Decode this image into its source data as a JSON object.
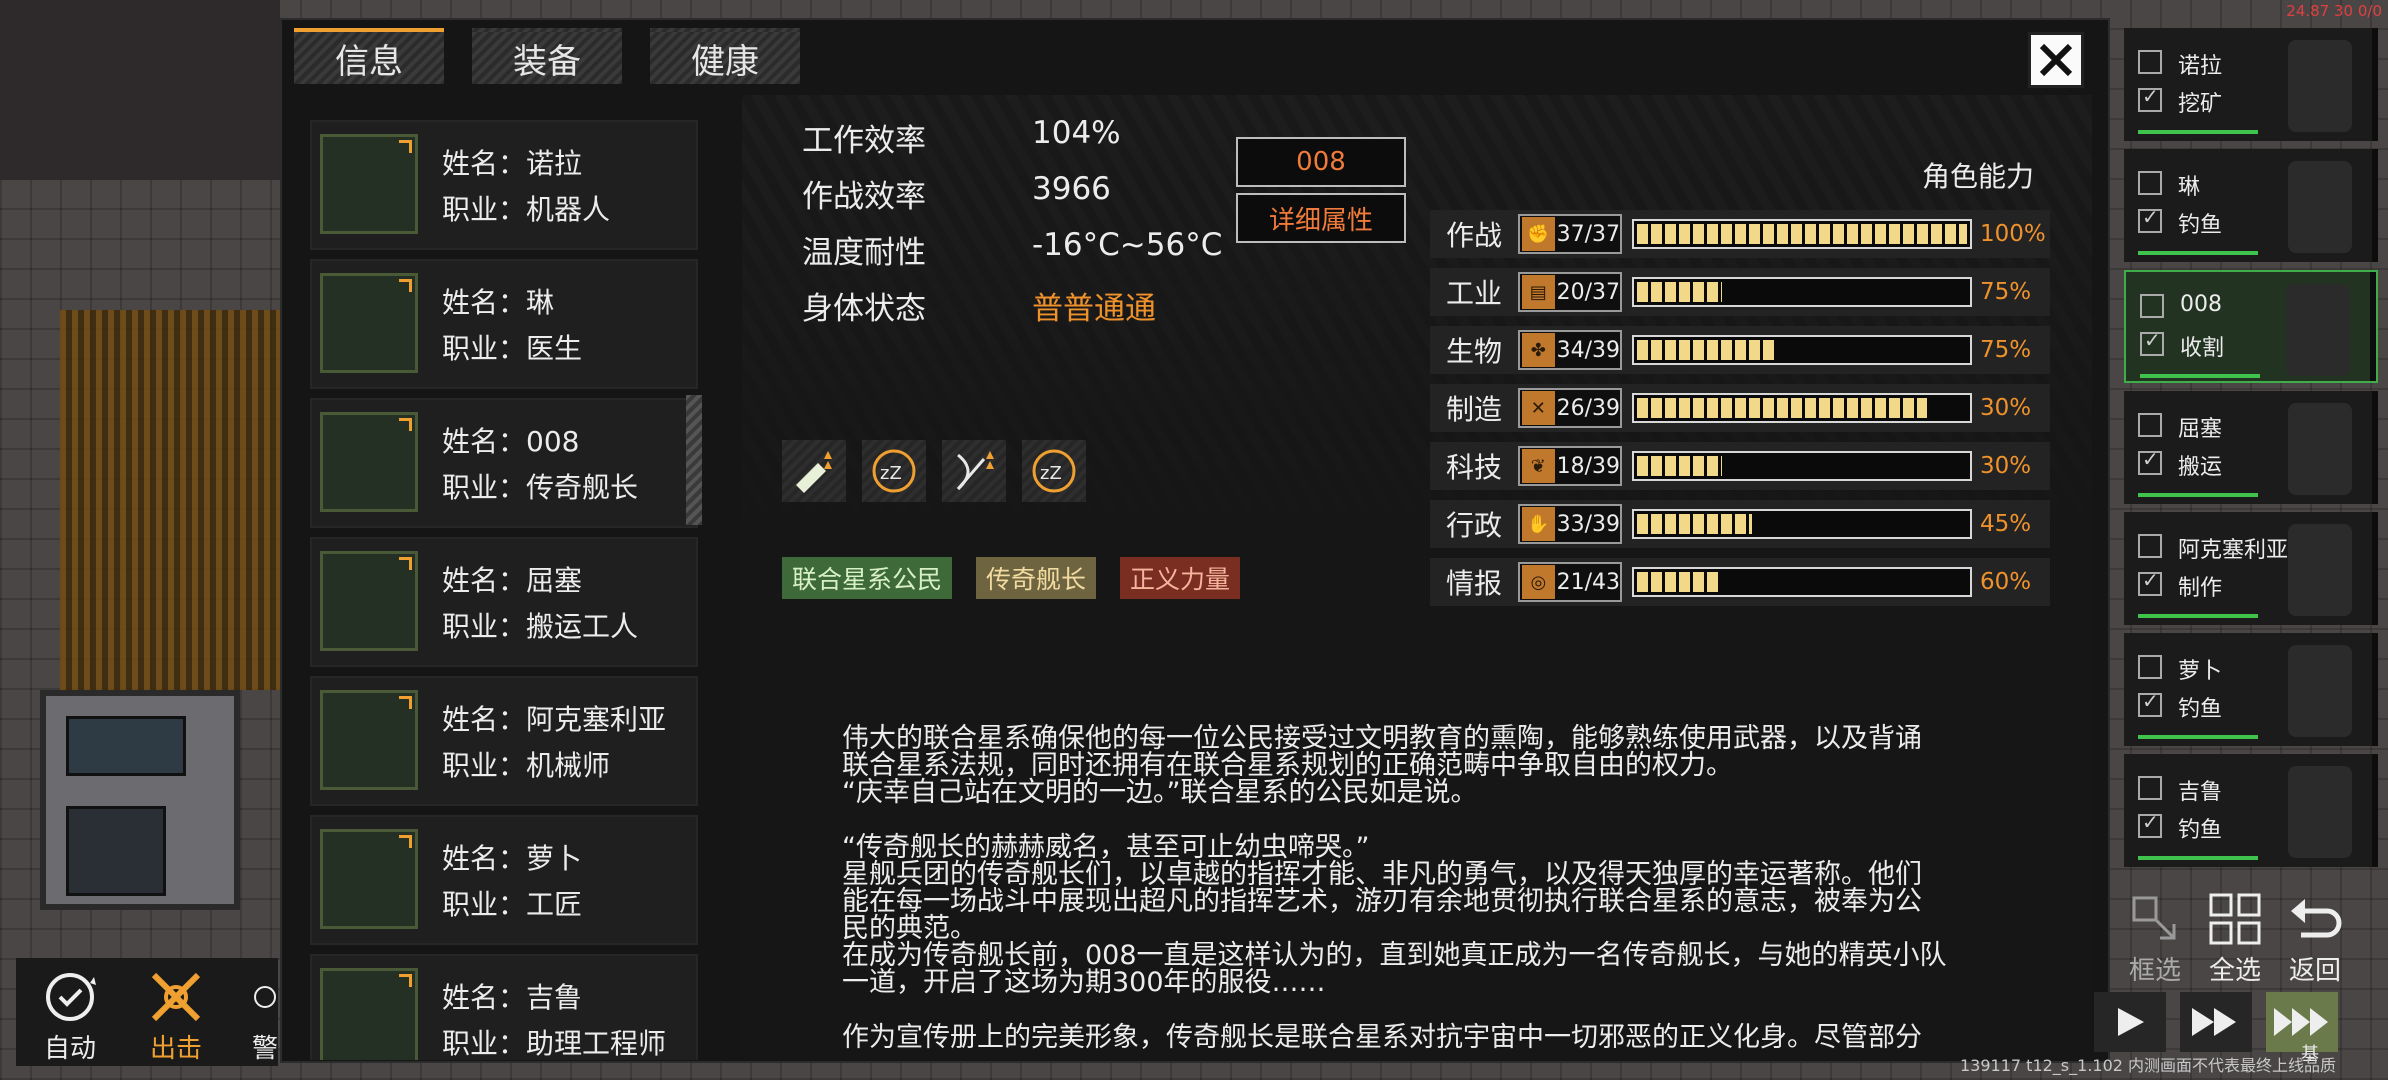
{
  "debug": {
    "top_right": "24.87 30 0/0",
    "bottom": "139117 t12_s_1.102 内测画面不代表最终上线品质"
  },
  "tabs": [
    {
      "label": "信息",
      "active": true
    },
    {
      "label": "装备",
      "active": false
    },
    {
      "label": "健康",
      "active": false
    }
  ],
  "close_icon": "close-icon",
  "characters": [
    {
      "name_label": "姓名：",
      "name": "诺拉",
      "job_label": "职业：",
      "job": "机器人"
    },
    {
      "name_label": "姓名：",
      "name": "琳",
      "job_label": "职业：",
      "job": "医生"
    },
    {
      "name_label": "姓名：",
      "name": "008",
      "job_label": "职业：",
      "job": "传奇舰长"
    },
    {
      "name_label": "姓名：",
      "name": "屈塞",
      "job_label": "职业：",
      "job": "搬运工人"
    },
    {
      "name_label": "姓名：",
      "name": "阿克塞利亚",
      "job_label": "职业：",
      "job": "机械师"
    },
    {
      "name_label": "姓名：",
      "name": "萝卜",
      "job_label": "职业：",
      "job": "工匠"
    },
    {
      "name_label": "姓名：",
      "name": "吉鲁",
      "job_label": "职业：",
      "job": "助理工程师"
    }
  ],
  "stats": {
    "work_label": "工作效率",
    "work_value": "104%",
    "combat_label": "作战效率",
    "combat_value": "3966",
    "temp_label": "温度耐性",
    "temp_value": "-16°C~56°C",
    "body_label": "身体状态",
    "body_value": "普普通通",
    "id_button": "008",
    "detail_button": "详细属性"
  },
  "status_icons": [
    "bullet-up-icon",
    "sleep-icon",
    "bow-up-icon",
    "sleep-icon"
  ],
  "tags": [
    "联合星系公民",
    "传奇舰长",
    "正义力量"
  ],
  "abilities": {
    "title": "角色能力",
    "rows": [
      {
        "name": "作战",
        "value": "37/37",
        "fill": 1.0,
        "pct": "100%",
        "icon": "fist-icon"
      },
      {
        "name": "工业",
        "value": "20/37",
        "fill": 0.27,
        "pct": "75%",
        "icon": "scroll-icon"
      },
      {
        "name": "生物",
        "value": "34/39",
        "fill": 0.43,
        "pct": "75%",
        "icon": "paw-icon"
      },
      {
        "name": "制造",
        "value": "26/39",
        "fill": 0.88,
        "pct": "30%",
        "icon": "tools-icon"
      },
      {
        "name": "科技",
        "value": "18/39",
        "fill": 0.27,
        "pct": "30%",
        "icon": "leaf-icon"
      },
      {
        "name": "行政",
        "value": "33/39",
        "fill": 0.36,
        "pct": "45%",
        "icon": "hand-icon"
      },
      {
        "name": "情报",
        "value": "21/43",
        "fill": 0.26,
        "pct": "60%",
        "icon": "target-icon"
      }
    ]
  },
  "description": {
    "p1": "伟大的联合星系确保他的每一位公民接受过文明教育的熏陶，能够熟练使用武器，以及背诵",
    "p2": "联合星系法规，同时还拥有在联合星系规划的正确范畴中争取自由的权力。",
    "p3": "“庆幸自己站在文明的一边。”联合星系的公民如是说。",
    "p4": "“传奇舰长的赫赫威名，甚至可止幼虫啼哭。”",
    "p5": "星舰兵团的传奇舰长们，以卓越的指挥才能、非凡的勇气，以及得天独厚的幸运著称。他们",
    "p6": "能在每一场战斗中展现出超凡的指挥艺术，游刃有余地贯彻执行联合星系的意志，被奉为公",
    "p7": "民的典范。",
    "p8": "在成为传奇舰长前，008一直是这样认为的，直到她真正成为一名传奇舰长，与她的精英小队",
    "p9": "一道，开启了这场为期300年的服役……",
    "p10": "作为宣传册上的完美形象，传奇舰长是联合星系对抗宇宙中一切邪恶的正义化身。尽管部分"
  },
  "roster": [
    {
      "name": "诺拉",
      "task": "挖矿",
      "selected": false
    },
    {
      "name": "琳",
      "task": "钓鱼",
      "selected": false
    },
    {
      "name": "008",
      "task": "收割",
      "selected": true
    },
    {
      "name": "屈塞",
      "task": "搬运",
      "selected": false
    },
    {
      "name": "阿克塞利亚",
      "task": "制作",
      "selected": false
    },
    {
      "name": "萝卜",
      "task": "钓鱼",
      "selected": false
    },
    {
      "name": "吉鲁",
      "task": "钓鱼",
      "selected": false
    }
  ],
  "controls": {
    "select_box": "框选",
    "select_all": "全选",
    "back": "返回",
    "auto": "自动",
    "attack": "出击",
    "alert": "警",
    "speed_partial": "基",
    "colors": {
      "accent": "#f0a030",
      "selected": "#3fae4a",
      "orange_text": "#f0922c"
    }
  }
}
